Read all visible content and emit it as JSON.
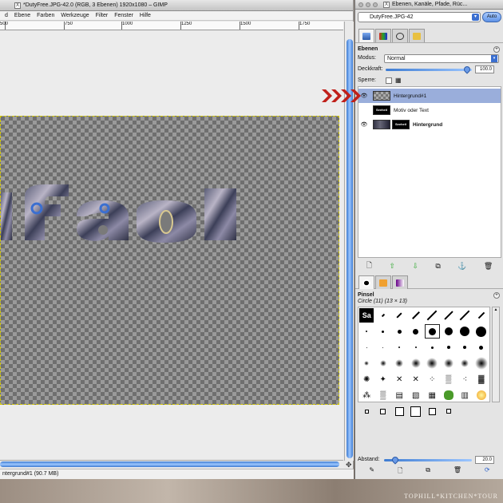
{
  "watermark": "TOPHILL*KITCHEN*TOUR",
  "main_window": {
    "title": "*DutyFree.JPG-42.0 (RGB, 3 Ebenen) 1920x1080 – GIMP",
    "menu": [
      "d",
      "Ebene",
      "Farben",
      "Werkzeuge",
      "Filter",
      "Fenster",
      "Hilfe"
    ],
    "ruler_labels": [
      "500",
      "750",
      "1000",
      "1250",
      "1500",
      "1750"
    ],
    "status": "ntergrund#1 (90.7 MB)"
  },
  "dock": {
    "title": "Ebenen, Kanäle, Pfade, Rüc...",
    "image_select": "DutyFree.JPG-42",
    "auto_button": "Auto",
    "layers_panel": {
      "title": "Ebenen",
      "mode_label": "Modus:",
      "mode_value": "Normal",
      "opacity_label": "Deckkraft:",
      "opacity_value": "100.0",
      "lock_label": "Sperre:",
      "layers": [
        {
          "name": "Hintergrund#1",
          "thumb_text": "",
          "selected": true,
          "visible": true,
          "bold": false
        },
        {
          "name": "Motiv oder Text",
          "thumb_text": "Seeheil",
          "selected": false,
          "visible": false,
          "bold": false
        },
        {
          "name": "Hintergrund",
          "thumb_text": "Seeheil",
          "selected": false,
          "visible": true,
          "bold": true
        }
      ]
    },
    "brushes_panel": {
      "title": "Pinsel",
      "current_brush": "Circle (11) (13 × 13)",
      "spacing_label": "Abstand:",
      "spacing_value": "20.0",
      "first_brush_text": "Sa"
    }
  },
  "colors": {
    "accent": "#3e7cd2",
    "selected_row": "#9aaedb",
    "arrow_red": "#c0201a"
  }
}
